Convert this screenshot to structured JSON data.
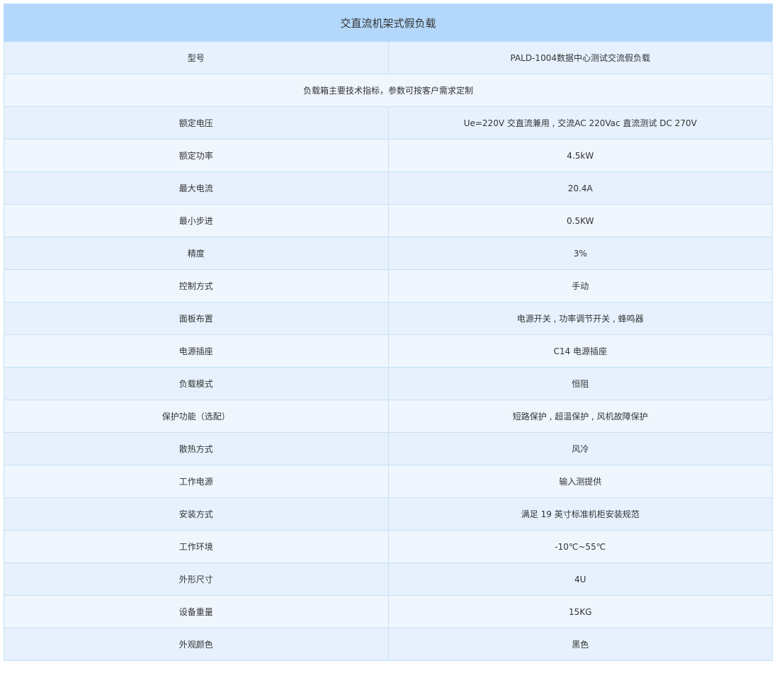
{
  "title": "交直流机架式假负载",
  "model": {
    "label": "型号",
    "value": "PALD-1004数据中心测试交流假负载"
  },
  "note": "负载箱主要技术指标，参数可按客户需求定制",
  "specs": [
    {
      "label": "额定电压",
      "value": "Ue=220V 交直流兼用 , 交流AC 220Vac 直流测试 DC 270V"
    },
    {
      "label": "额定功率",
      "value": "4.5kW"
    },
    {
      "label": "最大电流",
      "value": "20.4A"
    },
    {
      "label": "最小步进",
      "value": "0.5KW"
    },
    {
      "label": "精度",
      "value": "3%"
    },
    {
      "label": "控制方式",
      "value": "手动"
    },
    {
      "label": "面板布置",
      "value": "电源开关 , 功率调节开关 , 蜂鸣器"
    },
    {
      "label": "电源插座",
      "value": "C14 电源插座"
    },
    {
      "label": "负载模式",
      "value": "恒阻"
    },
    {
      "label": "保护功能（选配）",
      "value": "短路保护 , 超温保护 , 风机故障保护"
    },
    {
      "label": "散热方式",
      "value": "风冷"
    },
    {
      "label": "工作电源",
      "value": "输入测提供"
    },
    {
      "label": "安装方式",
      "value": "满足 19 英寸标准机柜安装规范"
    },
    {
      "label": "工作环境",
      "value": "-10℃~55℃"
    },
    {
      "label": "外形尺寸",
      "value": "4U"
    },
    {
      "label": "设备重量",
      "value": "15KG"
    },
    {
      "label": "外观颜色",
      "value": "黑色"
    }
  ],
  "colors": {
    "header_bg": "#b3d8fb",
    "row_bg_a": "#e6f1fd",
    "row_bg_b": "#eff6fe",
    "border": "#c7e1f2"
  }
}
